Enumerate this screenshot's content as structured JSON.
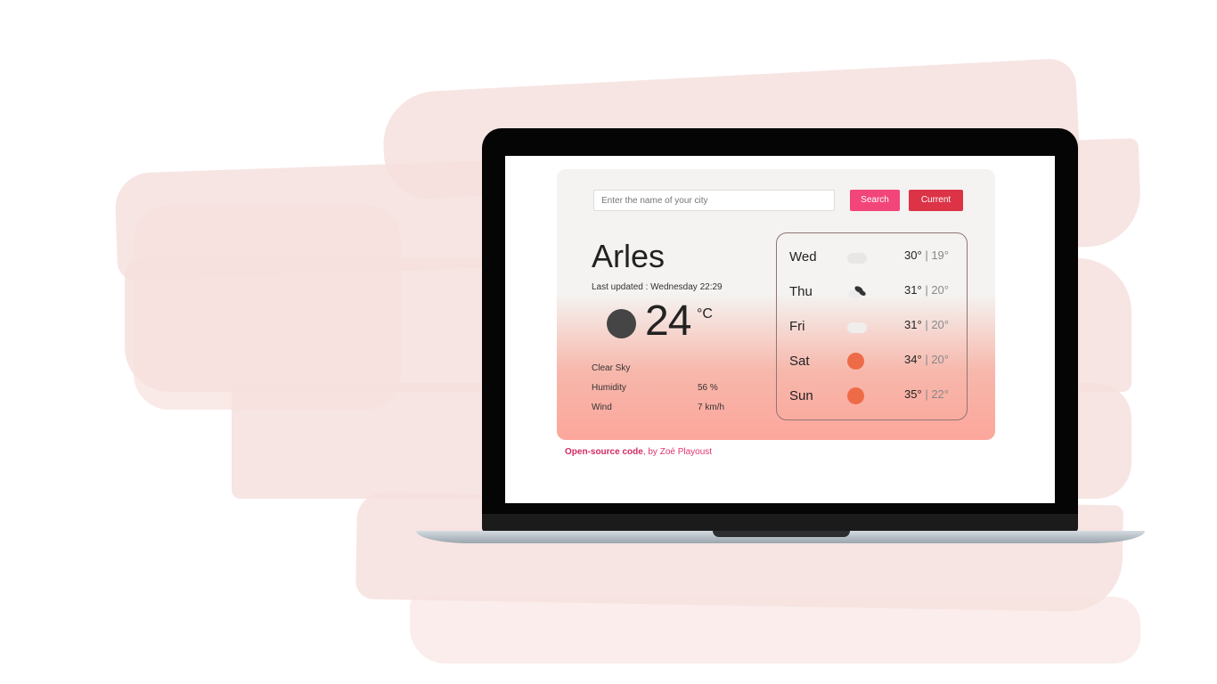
{
  "search": {
    "placeholder": "Enter the name of your city",
    "search_label": "Search",
    "current_label": "Current"
  },
  "weather": {
    "city": "Arles",
    "last_updated": "Last updated : Wednesday 22:29",
    "temperature": "24",
    "unit": "°C",
    "description": "Clear Sky",
    "humidity_label": "Humidity",
    "humidity_value": "56 %",
    "wind_label": "Wind",
    "wind_value": "7 km/h"
  },
  "forecast": [
    {
      "day": "Wed",
      "max": "30°",
      "sep": " | ",
      "min": "19°",
      "icon": "cloud-icon"
    },
    {
      "day": "Thu",
      "max": "31°",
      "sep": " | ",
      "min": "20°",
      "icon": "broken-clouds-icon"
    },
    {
      "day": "Fri",
      "max": "31°",
      "sep": " | ",
      "min": "20°",
      "icon": "cloud-icon"
    },
    {
      "day": "Sat",
      "max": "34°",
      "sep": " | ",
      "min": "20°",
      "icon": "sun-icon"
    },
    {
      "day": "Sun",
      "max": "35°",
      "sep": " | ",
      "min": "22°",
      "icon": "sun-icon"
    }
  ],
  "footer": {
    "link_text": "Open-source code",
    "author_text": ", by Zoé Playoust"
  },
  "colors": {
    "search_button": "#f2457a",
    "current_button": "#dc3347",
    "sun": "#ee6b48",
    "footer_link": "#d12b62"
  }
}
